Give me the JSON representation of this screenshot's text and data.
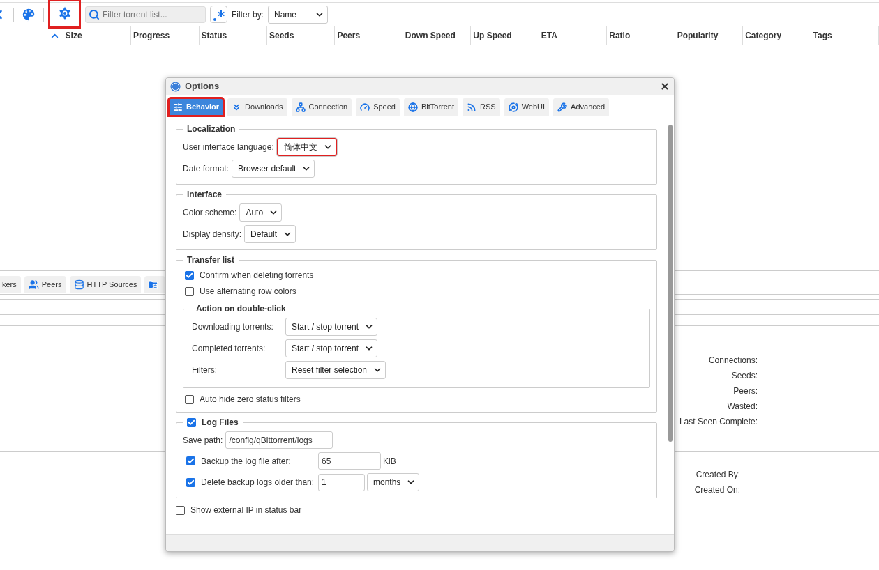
{
  "toolbar": {
    "settings_highlighted": true,
    "search": {
      "placeholder": "Filter torrent list..."
    },
    "filter_label": "Filter by:",
    "filter_value": "Name"
  },
  "table": {
    "columns": [
      "Size",
      "Progress",
      "Status",
      "Seeds",
      "Peers",
      "Down Speed",
      "Up Speed",
      "ETA",
      "Ratio",
      "Popularity",
      "Category",
      "Tags"
    ]
  },
  "details_tabs": [
    {
      "label": "kers",
      "kind": "plain"
    },
    {
      "label": "Peers",
      "kind": "peers"
    },
    {
      "label": "HTTP Sources",
      "kind": "sources"
    }
  ],
  "transfer_info": [
    "Connections:",
    "Seeds:",
    "Peers:",
    "Wasted:",
    "Last Seen Complete:"
  ],
  "torrent_info": [
    "Created By:",
    "Created On:"
  ],
  "dialog": {
    "title": "Options",
    "tabs": [
      {
        "label": "Behavior",
        "kind": "behavior",
        "selected": true,
        "highlighted": true
      },
      {
        "label": "Downloads",
        "kind": "downloads",
        "selected": false,
        "highlighted": false
      },
      {
        "label": "Connection",
        "kind": "connection",
        "selected": false,
        "highlighted": false
      },
      {
        "label": "Speed",
        "kind": "speed",
        "selected": false,
        "highlighted": false
      },
      {
        "label": "BitTorrent",
        "kind": "bittorrent",
        "selected": false,
        "highlighted": false
      },
      {
        "label": "RSS",
        "kind": "rss",
        "selected": false,
        "highlighted": false
      },
      {
        "label": "WebUI",
        "kind": "webui",
        "selected": false,
        "highlighted": false
      },
      {
        "label": "Advanced",
        "kind": "advanced",
        "selected": false,
        "highlighted": false
      }
    ],
    "sections": [
      {
        "title": "Localization",
        "items": [
          {
            "kind": "select",
            "label": "User interface language:",
            "value": "简体中文",
            "highlighted": true
          },
          {
            "kind": "select",
            "label": "Date format:",
            "value": "Browser default",
            "highlighted": false
          }
        ]
      },
      {
        "title": "Interface",
        "items": [
          {
            "kind": "select",
            "label": "Color scheme:",
            "value": "Auto",
            "highlighted": false
          },
          {
            "kind": "select",
            "label": "Display density:",
            "value": "Default",
            "highlighted": false
          }
        ]
      },
      {
        "title": "Transfer list",
        "items": [
          {
            "kind": "checkbox",
            "label": "Confirm when deleting torrents",
            "checked": true
          },
          {
            "kind": "checkbox",
            "label": "Use alternating row colors",
            "checked": false
          },
          {
            "kind": "group",
            "title": "Action on double-click",
            "items": [
              {
                "kind": "select",
                "label": "Downloading torrents:",
                "value": "Start / stop torrent",
                "highlighted": false
              },
              {
                "kind": "select",
                "label": "Completed torrents:",
                "value": "Start / stop torrent",
                "highlighted": false
              },
              {
                "kind": "select",
                "label": "Filters:",
                "value": "Reset filter selection",
                "highlighted": false
              }
            ]
          },
          {
            "kind": "checkbox",
            "label": "Auto hide zero status filters",
            "checked": false
          }
        ]
      },
      {
        "title": "Log Files",
        "checked": true,
        "items": [
          {
            "kind": "text",
            "label": "Save path:",
            "value": "/config/qBittorrent/logs"
          },
          {
            "kind": "checkbox_input",
            "label": "Backup the log file after:",
            "checked": true,
            "value": "65",
            "unit": "KiB"
          },
          {
            "kind": "checkbox_input",
            "label": "Delete backup logs older than:",
            "checked": true,
            "value": "1",
            "unit_select": "months"
          }
        ]
      }
    ],
    "footer_checkbox": {
      "label": "Show external IP in status bar",
      "checked": false
    }
  }
}
